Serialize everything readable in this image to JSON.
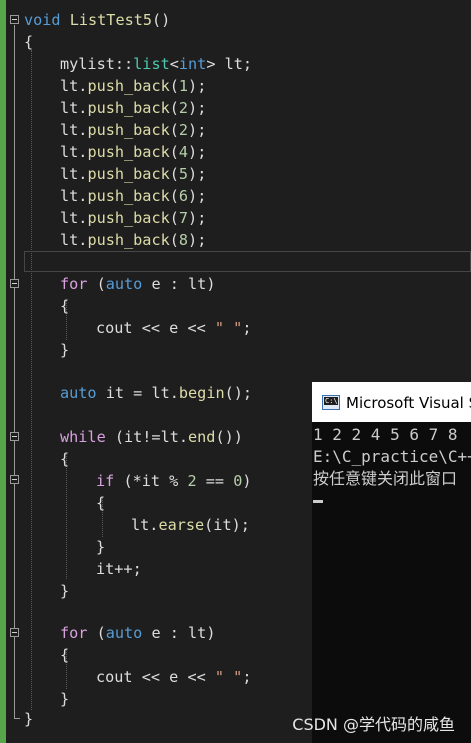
{
  "editor": {
    "lines": {
      "l1": {
        "kw": "void",
        "fn": "ListTest5",
        "punc": "()"
      },
      "l2": {
        "text": "{"
      },
      "l3": {
        "pre": "mylist::",
        "ty": "list",
        "lt": "<",
        "kw": "int",
        "gt": ">",
        "var": " lt;"
      },
      "l4": {
        "obj": "lt.",
        "fn": "push_back",
        "open": "(",
        "num": "1",
        "close": ");"
      },
      "l5": {
        "obj": "lt.",
        "fn": "push_back",
        "open": "(",
        "num": "2",
        "close": ");"
      },
      "l6": {
        "obj": "lt.",
        "fn": "push_back",
        "open": "(",
        "num": "2",
        "close": ");"
      },
      "l7": {
        "obj": "lt.",
        "fn": "push_back",
        "open": "(",
        "num": "4",
        "close": ");"
      },
      "l8": {
        "obj": "lt.",
        "fn": "push_back",
        "open": "(",
        "num": "5",
        "close": ");"
      },
      "l9": {
        "obj": "lt.",
        "fn": "push_back",
        "open": "(",
        "num": "6",
        "close": ");"
      },
      "l10": {
        "obj": "lt.",
        "fn": "push_back",
        "open": "(",
        "num": "7",
        "close": ");"
      },
      "l11": {
        "obj": "lt.",
        "fn": "push_back",
        "open": "(",
        "num": "8",
        "close": ");"
      },
      "l13": {
        "ctl": "for",
        "a": " (",
        "kw": "auto",
        "b": " e : lt)"
      },
      "l14": {
        "text": "{"
      },
      "l15": {
        "a": "cout",
        "b": " << ",
        "c": "e",
        "d": " << ",
        "str": "\" \"",
        "e": ";"
      },
      "l16": {
        "text": "}"
      },
      "l18": {
        "kw": "auto",
        "a": " it = ",
        "obj": "lt.",
        "fn": "begin",
        "b": "();"
      },
      "l20": {
        "ctl": "while",
        "a": " (it!=lt.",
        "fn": "end",
        "b": "())"
      },
      "l21": {
        "text": "{"
      },
      "l22": {
        "ctl": "if",
        "a": " (*it % ",
        "num1": "2",
        "b": " == ",
        "num2": "0",
        "c": ")"
      },
      "l23": {
        "text": "{"
      },
      "l24": {
        "obj": "lt.",
        "fn": "earse",
        "b": "(it);"
      },
      "l25": {
        "text": "}"
      },
      "l26": {
        "text": "it++;"
      },
      "l27": {
        "text": "}"
      },
      "l29": {
        "ctl": "for",
        "a": " (",
        "kw": "auto",
        "b": " e : lt)"
      },
      "l30": {
        "text": "{"
      },
      "l31": {
        "a": "cout",
        "b": " << ",
        "c": "e",
        "d": " << ",
        "str": "\" \"",
        "e": ";"
      },
      "l32": {
        "text": "}"
      },
      "l33": {
        "text": "}"
      }
    }
  },
  "console": {
    "title": "Microsoft Visual Studio 调试控制台",
    "icon_text": "C:\\",
    "lines": [
      "1 2 2 4 5 6 7 8",
      "E:\\C_practice\\C++",
      "按任意键关闭此窗口"
    ]
  },
  "watermark": "CSDN @学代码的咸鱼",
  "colors": {
    "background": "#1e1e1e",
    "keyword": "#569cd6",
    "control": "#d8a0df",
    "type": "#4ec9b0",
    "function": "#dcdcaa",
    "string": "#d69d85",
    "number": "#b5cea8",
    "gutter": "#57a64a"
  }
}
